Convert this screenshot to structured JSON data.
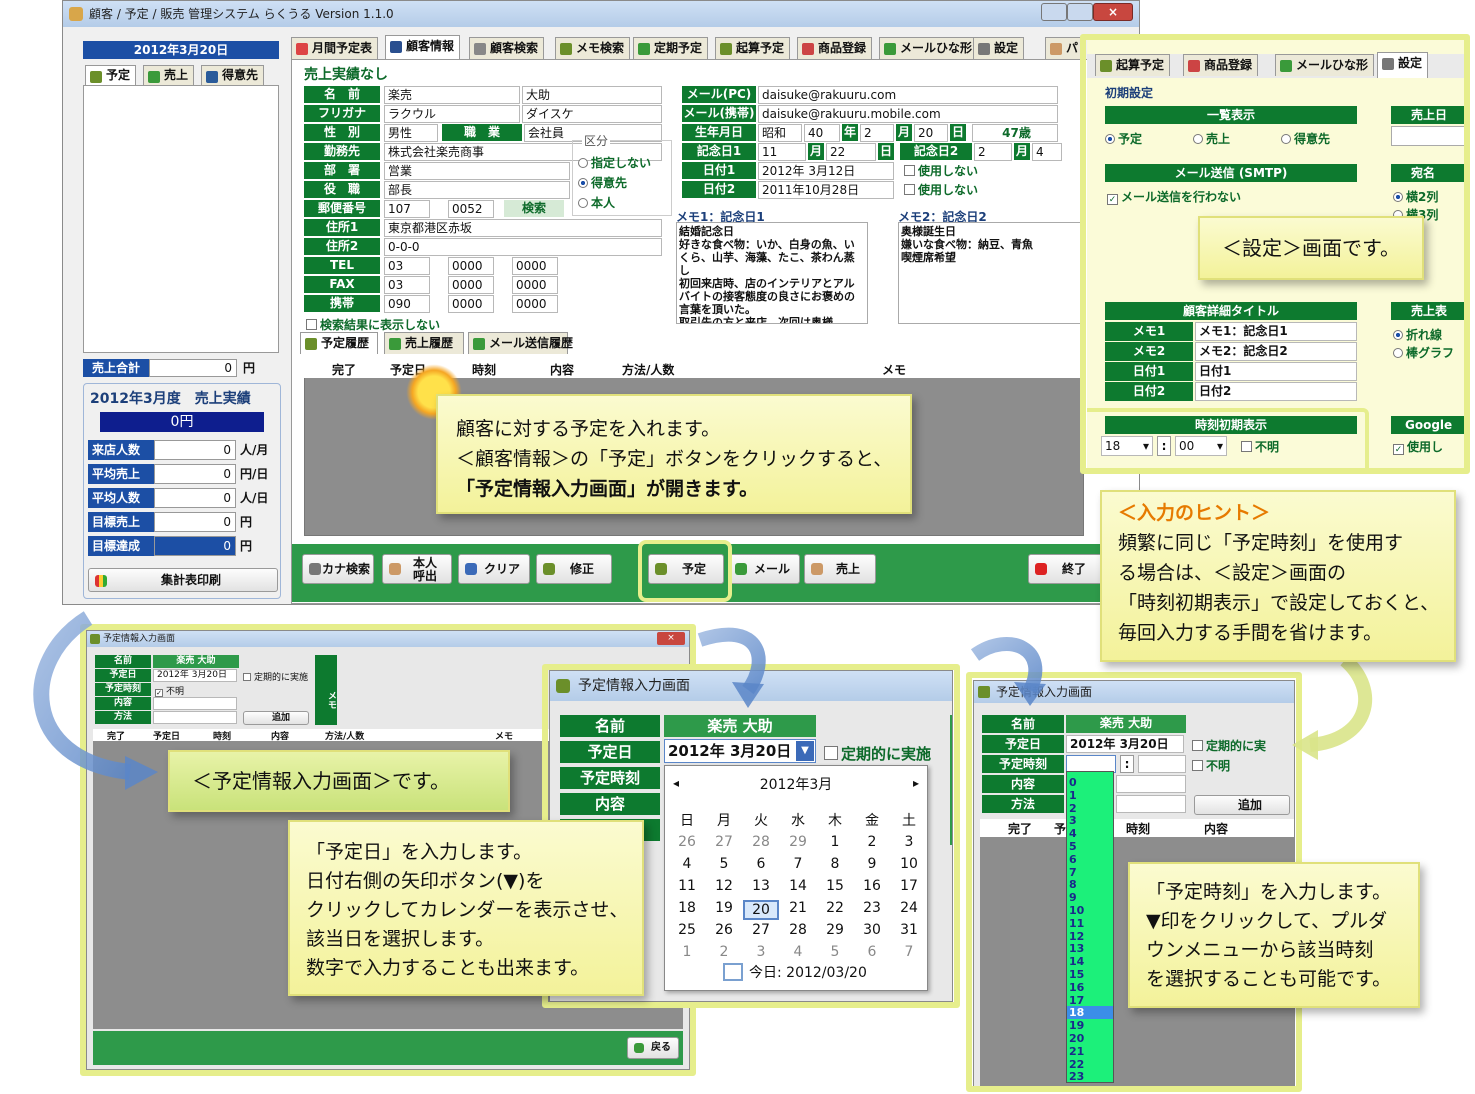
{
  "main_window": {
    "title": "顧客 / 予定 / 販売 管理システム らくうる  Version 1.1.0",
    "date": "2012年3月20日",
    "left_tabs": [
      "予定",
      "売上",
      "得意先"
    ],
    "sales_total_label": "売上合計",
    "sales_total_value": "0",
    "unit_yen": "円",
    "monthly_title": "2012年3月度　売上実績",
    "monthly_amount": "0円",
    "stats": [
      {
        "label": "来店人数",
        "value": "0",
        "unit": "人/月"
      },
      {
        "label": "平均売上",
        "value": "0",
        "unit": "円/日"
      },
      {
        "label": "平均人数",
        "value": "0",
        "unit": "人/日"
      },
      {
        "label": "目標売上",
        "value": "0",
        "unit": "円"
      },
      {
        "label": "目標達成",
        "value": "0",
        "unit": "円"
      }
    ],
    "print_button": "集計表印刷",
    "tabs": [
      "月間予定表",
      "顧客情報",
      "顧客検索",
      "メモ検索",
      "定期予定",
      "起算予定",
      "商品登録",
      "メールひな形",
      "設定",
      "パ"
    ],
    "no_sales": "売上実績なし",
    "fields": {
      "name_label": "名　前",
      "name_last": "楽売",
      "name_first": "大助",
      "kana_label": "フリガナ",
      "kana_last": "ラクウル",
      "kana_first": "ダイスケ",
      "gender_label": "性　別",
      "gender": "男性",
      "job_label": "職　業",
      "job": "会社員",
      "company_label": "勤務先",
      "company": "株式会社楽売商事",
      "dept_label": "部　署",
      "dept": "営業",
      "title_label": "役　職",
      "title": "部長",
      "zip_label": "郵便番号",
      "zip1": "107",
      "zip2": "0052",
      "search_button": "検索",
      "addr1_label": "住所1",
      "addr1": "東京都港区赤坂",
      "addr2_label": "住所2",
      "addr2": "0-0-0",
      "tel_label": "TEL",
      "tel": [
        "03",
        "0000",
        "0000"
      ],
      "fax_label": "FAX",
      "fax": [
        "03",
        "0000",
        "0000"
      ],
      "mobile_label": "携帯",
      "mobile": [
        "090",
        "0000",
        "0000"
      ],
      "hide_search": "検索結果に表示しない"
    },
    "category": {
      "label": "区分",
      "options": [
        "指定しない",
        "得意先",
        "本人"
      ],
      "selected": 1
    },
    "right_fields": {
      "mail_pc_label": "メール(PC)",
      "mail_pc": "daisuke@rakuuru.com",
      "mail_mobile_label": "メール(携帯)",
      "mail_mobile": "daisuke@rakuuru.mobile.com",
      "birth_label": "生年月日",
      "birth_era": "昭和",
      "birth_year": "40",
      "birth_month": "2",
      "birth_day": "20",
      "age": "47歳",
      "nen": "年",
      "tsuki": "月",
      "nichi": "日",
      "anniv1_label": "記念日1",
      "anniv1_month": "11",
      "anniv1_day": "22",
      "anniv2_label": "記念日2",
      "anniv2_month": "2",
      "anniv2_day": "4",
      "date1_label": "日付1",
      "date1": "2012年 3月12日",
      "date2_label": "日付2",
      "date2": "2011年10月28日",
      "unused": "使用しない"
    },
    "memo1_title": "メモ1：記念日1",
    "memo1_text": "結婚記念日\n好きな食べ物：いか、白身の魚、いくら、山芋、海藻、たこ、茶わん蒸し\n初回来店時、店のインテリアとアルバイトの接客態度の良さにお褒めの言葉を頂いた。\n取引先の方と来店。次回は奥様",
    "memo2_title": "メモ2：記念日2",
    "memo2_text": "奥様誕生日\n嫌いな食べ物：納豆、青魚\n喫煙席希望",
    "history_tabs": [
      "予定履歴",
      "売上履歴",
      "メール送信履歴"
    ],
    "history_columns": [
      "完了",
      "予定日",
      "時刻",
      "内容",
      "方法/人数",
      "メモ"
    ],
    "bottom_buttons": [
      "カナ検索",
      "本人\n呼出",
      "クリア",
      "修正",
      "予定",
      "メール",
      "売上",
      "終了"
    ]
  },
  "settings_window": {
    "tabs": [
      "起算予定",
      "商品登録",
      "メールひな形",
      "設定"
    ],
    "section_title": "初期設定",
    "list_display": "一覧表示",
    "list_options": [
      "予定",
      "売上",
      "得意先"
    ],
    "sales_col": "売上日",
    "smtp_title": "メール送信 (SMTP)",
    "smtp_check": "メール送信を行わない",
    "address_title": "宛名",
    "address_options": [
      "横2列",
      "横3列"
    ],
    "detail_title": "顧客詳細タイトル",
    "detail_rows": [
      {
        "label": "メモ1",
        "value": "メモ1：記念日1"
      },
      {
        "label": "メモ2",
        "value": "メモ2：記念日2"
      },
      {
        "label": "日付1",
        "value": "日付1"
      },
      {
        "label": "日付2",
        "value": "日付2"
      }
    ],
    "sales_graph_title": "売上表",
    "sales_graph_options": [
      "折れ線",
      "棒グラフ"
    ],
    "time_title": "時刻初期表示",
    "time_hour": "18",
    "time_min": "00",
    "time_unknown": "不明",
    "google_title": "Google",
    "google_use": "使用し"
  },
  "callouts": {
    "settings_screen": "＜設定＞画面です。",
    "schedule_intro_1": "顧客に対する予定を入れます。",
    "schedule_intro_2": "＜顧客情報＞の「予定」ボタンをクリックすると、",
    "schedule_intro_3": "「予定情報入力画面」が開きます。",
    "hint_title": "＜入力のヒント＞",
    "hint_1": "頻繁に同じ「予定時刻」を使用す",
    "hint_2": "る場合は、＜設定＞画面の",
    "hint_3": "「時刻初期表示」で設定しておくと、",
    "hint_4": "毎回入力する手間を省けます。",
    "entry_screen": "＜予定情報入力画面＞です。",
    "date_1": "「予定日」を入力します。",
    "date_2": "日付右側の矢印ボタン(▼)を",
    "date_3": "クリックしてカレンダーを表示させ、",
    "date_4": "該当日を選択します。",
    "date_5": "数字で入力することも出来ます。",
    "time_1": "「予定時刻」を入力します。",
    "time_2": "▼印をクリックして、プルダ",
    "time_3": "ウンメニューから該当時刻",
    "time_4": "を選択することも可能です。"
  },
  "entry_small": {
    "title": "予定情報入力画面",
    "name_label": "名前",
    "name": "楽売 大助",
    "date_label": "予定日",
    "date": "2012年 3月20日",
    "time_label": "予定時刻",
    "unknown": "不明",
    "content_label": "内容",
    "method_label": "方法",
    "add": "追加",
    "periodic": "定期的に実施",
    "memo_side": "メモ",
    "columns": [
      "完了",
      "予定日",
      "時刻",
      "内容",
      "方法/人数",
      "メモ"
    ],
    "back": "戻る"
  },
  "entry_calendar": {
    "title": "予定情報入力画面",
    "name_label": "名前",
    "name": "楽売 大助",
    "date_label": "予定日",
    "date": "2012年 3月20日",
    "time_label": "予定時刻",
    "content_label": "内容",
    "periodic": "定期的に実施",
    "month": "2012年3月",
    "weekdays": [
      "日",
      "月",
      "火",
      "水",
      "木",
      "金",
      "土"
    ],
    "days": [
      "26",
      "27",
      "28",
      "29",
      "1",
      "2",
      "3",
      "4",
      "5",
      "6",
      "7",
      "8",
      "9",
      "10",
      "11",
      "12",
      "13",
      "14",
      "15",
      "16",
      "17",
      "18",
      "19",
      "20",
      "21",
      "22",
      "23",
      "24",
      "25",
      "26",
      "27",
      "28",
      "29",
      "30",
      "31",
      "1",
      "2",
      "3",
      "4",
      "5",
      "6",
      "7"
    ],
    "today": "今日: 2012/03/20"
  },
  "entry_time": {
    "title": "予定情報入力画面",
    "name_label": "名前",
    "name": "楽売 大助",
    "date_label": "予定日",
    "date": "2012年 3月20日",
    "time_label": "予定時刻",
    "content_label": "内容",
    "method_label": "方法",
    "periodic": "定期的に実",
    "unknown": "不明",
    "add": "追加",
    "columns": [
      "完了",
      "予",
      "時刻",
      "内容"
    ],
    "hours": [
      "0",
      "1",
      "2",
      "3",
      "4",
      "5",
      "6",
      "7",
      "8",
      "9",
      "10",
      "11",
      "12",
      "13",
      "14",
      "15",
      "16",
      "17",
      "18",
      "19",
      "20",
      "21",
      "22",
      "23"
    ],
    "selected_hour": "18"
  },
  "colors": {
    "form_green": "#0d7a2f",
    "callout_yellow": "#f6f5a8",
    "frame_yellow": "#e6ee8c",
    "dropdown_green": "#1cf07a"
  }
}
